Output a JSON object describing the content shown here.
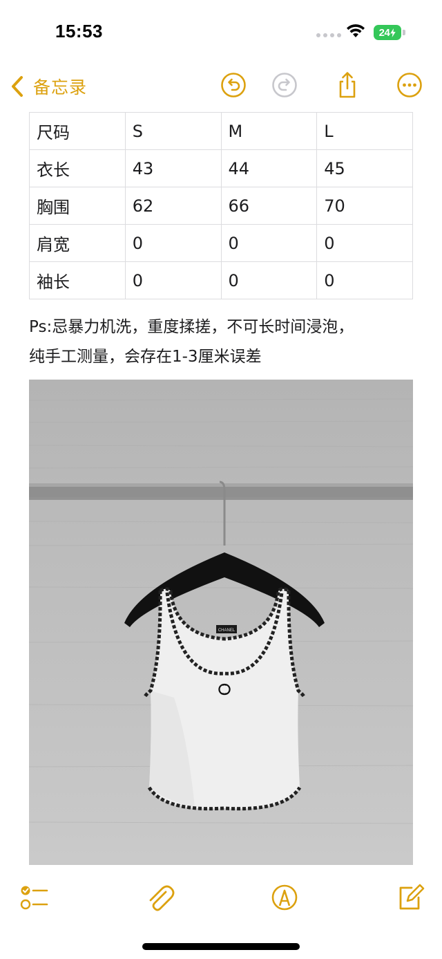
{
  "status_bar": {
    "time": "15:53",
    "battery_level": "24",
    "icons": [
      "signal-dots-icon",
      "wifi-icon",
      "battery-charging-icon"
    ]
  },
  "nav": {
    "back_label": "备忘录",
    "icons": [
      "chevron-left-icon",
      "undo-icon",
      "redo-icon",
      "share-icon",
      "more-icon"
    ],
    "accent_color": "#dca10f",
    "disabled_color": "#c7c7cc"
  },
  "size_table": {
    "rows": [
      [
        "尺码",
        "S",
        "M",
        "L"
      ],
      [
        "衣长",
        "43",
        "44",
        "45"
      ],
      [
        "胸围",
        "62",
        "66",
        "70"
      ],
      [
        "肩宽",
        "0",
        "0",
        "0"
      ],
      [
        "袖长",
        "0",
        "0",
        "0"
      ]
    ]
  },
  "note": {
    "line1": "Ps:忌暴力机洗，重度揉搓，不可长时间浸泡，",
    "line2": "纯手工测量，会存在1-3厘米误差"
  },
  "photo": {
    "logo_text": "CHANEL",
    "description_icon": "product-photo"
  },
  "toolbar": {
    "icons": [
      "checklist-icon",
      "attachment-icon",
      "markup-icon",
      "compose-icon"
    ]
  }
}
